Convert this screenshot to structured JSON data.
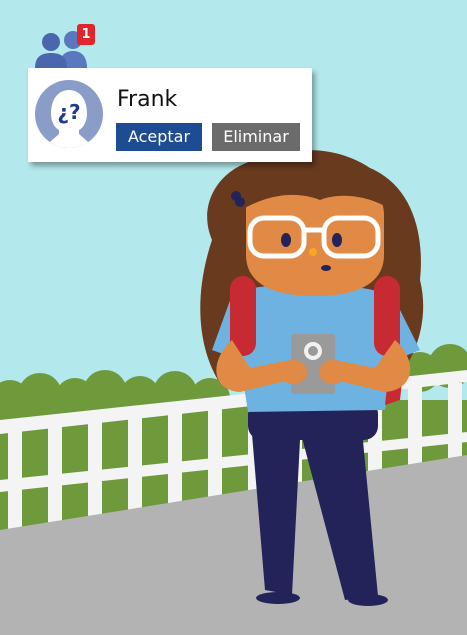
{
  "notification": {
    "icon": "friend-requests-icon",
    "count": "1",
    "badge_color": "#e0262b"
  },
  "friend_request": {
    "avatar": "unknown-user-avatar",
    "avatar_glyph": "¿?",
    "name": "Frank",
    "accept_label": "Aceptar",
    "delete_label": "Eliminar",
    "accept_color": "#1e4c93",
    "delete_color": "#6b6b6b"
  },
  "colors": {
    "sky": "#b3e9ec",
    "ground": "#b3b3b3",
    "hedge": "#6e9a3b"
  }
}
